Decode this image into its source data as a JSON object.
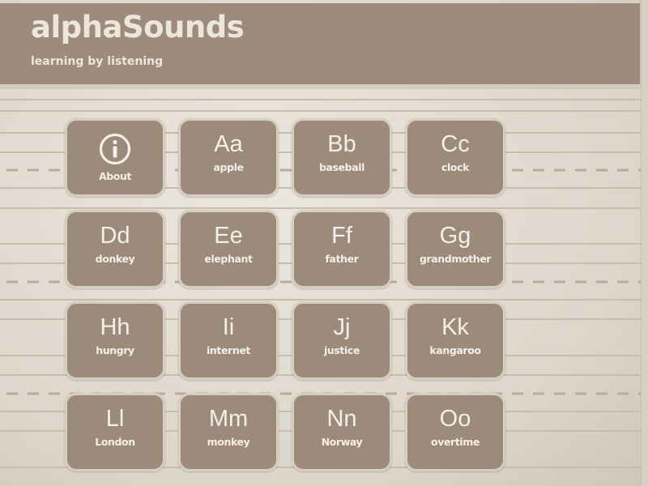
{
  "header": {
    "title": "alphaSounds",
    "subtitle": "learning by listening"
  },
  "about": {
    "label": "About",
    "icon": "info-circle-icon"
  },
  "letters": [
    {
      "letters": "Aa",
      "word": "apple"
    },
    {
      "letters": "Bb",
      "word": "baseball"
    },
    {
      "letters": "Cc",
      "word": "clock"
    },
    {
      "letters": "Dd",
      "word": "donkey"
    },
    {
      "letters": "Ee",
      "word": "elephant"
    },
    {
      "letters": "Ff",
      "word": "father"
    },
    {
      "letters": "Gg",
      "word": "grandmother"
    },
    {
      "letters": "Hh",
      "word": "hungry"
    },
    {
      "letters": "Ii",
      "word": "internet"
    },
    {
      "letters": "Jj",
      "word": "justice"
    },
    {
      "letters": "Kk",
      "word": "kangaroo"
    },
    {
      "letters": "Ll",
      "word": "London"
    },
    {
      "letters": "Mm",
      "word": "monkey"
    },
    {
      "letters": "Nn",
      "word": "Norway"
    },
    {
      "letters": "Oo",
      "word": "overtime"
    }
  ],
  "colors": {
    "header_bg": "#9d8c7c",
    "tile_bg": "#9c8b7a",
    "tile_border": "#d7cec2",
    "text_light": "#f4efe8",
    "paper": "#e6e0d7"
  }
}
